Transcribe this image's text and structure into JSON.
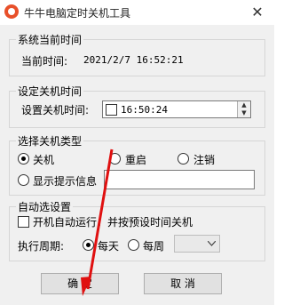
{
  "window": {
    "title": "牛牛电脑定时关机工具",
    "close_glyph": "✕",
    "icon": "app-logo-icon",
    "accent": "#e8502a"
  },
  "current_time": {
    "group_title": "系统当前时间",
    "label": "当前时间:",
    "value": "2021/2/7 16:52:21"
  },
  "set_shutdown": {
    "group_title": "设定关机时间",
    "label": "设置关机时间:",
    "time_value": "16:50:24"
  },
  "shutdown_type": {
    "group_title": "选择关机类型",
    "options": [
      {
        "label": "关机",
        "selected": true
      },
      {
        "label": "重启",
        "selected": false
      },
      {
        "label": "注销",
        "selected": false
      }
    ],
    "show_message_label": "显示提示信息",
    "message_value": ""
  },
  "auto": {
    "group_title": "自动选设置",
    "autostart_label": "开机自动运行，并按预设时间关机",
    "period_label": "执行周期:",
    "period_options": [
      {
        "label": "每天",
        "selected": true
      },
      {
        "label": "每周",
        "selected": false
      }
    ],
    "weekday_value": ""
  },
  "buttons": {
    "ok": "确    定",
    "cancel": "取    消"
  }
}
